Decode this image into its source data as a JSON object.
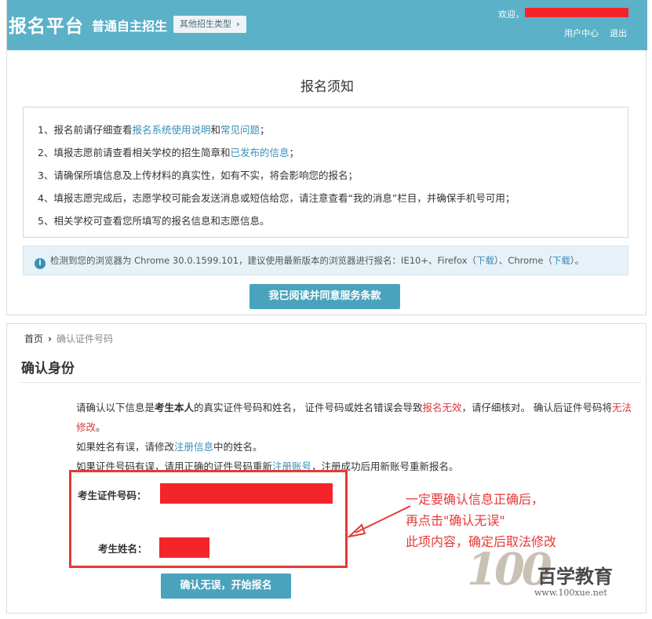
{
  "header": {
    "logo": "报名平台",
    "type_name": "普通自主招生",
    "other_types_label": "其他招生类型",
    "welcome": "欢迎，",
    "user_center": "用户中心",
    "logout": "退出"
  },
  "notice": {
    "title": "报名须知",
    "item1": {
      "a": "1、报名前请仔细查看",
      "link1": "报名系统使用说明",
      "b": "和",
      "link2": "常见问题",
      "c": "；"
    },
    "item2": {
      "a": "2、填报志愿前请查看相关学校的招生简章和",
      "link1": "已发布的信息",
      "b": "；"
    },
    "item3": "3、请确保所填信息及上传材料的真实性，如有不实，将会影响您的报名；",
    "item4": "4、填报志愿完成后，志愿学校可能会发送消息或短信给您，请注意查看“我的消息”栏目，并确保手机号可用；",
    "item5": "5、相关学校可查看您所填写的报名信息和志愿信息。"
  },
  "browser_tip": {
    "a": "检测到您的浏览器为 Chrome 30.0.1599.101，建议使用最新版本的浏览器进行报名：IE10+、Firefox（",
    "download1": "下载",
    "b": "）、Chrome（",
    "download2": "下载",
    "c": "）。"
  },
  "agree_button": "我已阅读并同意服务条款",
  "breadcrumb": {
    "home": "首页",
    "current": "确认证件号码"
  },
  "confirm": {
    "title": "确认身份",
    "p1_a": "请确认以下信息是",
    "p1_b": "考生本人",
    "p1_c": "的真实证件号码和姓名，  证件号码或姓名错误会导致",
    "p1_d": "报名无效",
    "p1_e": "，请仔细核对。  确认后证件号码将",
    "p1_f": "无法修改",
    "p1_g": "。",
    "p2_a": "如果姓名有误，请修改",
    "p2_link": "注册信息",
    "p2_b": "中的姓名。",
    "p3_a": "如果证件号码有误，请用正确的证件号码重新",
    "p3_link": "注册账号",
    "p3_b": "，注册成功后用新账号重新报名。",
    "id_label": "考生证件号码：",
    "name_label": "考生姓名：",
    "start_button": "确认无误，开始报名"
  },
  "annotation": {
    "line1": "一定要确认信息正确后，",
    "line2": "再点击\"确认无误\"",
    "line3": "此项内容，确定后取法修改"
  },
  "watermark": {
    "number": "100",
    "name": "百学教育",
    "url": "www.100xue.net"
  },
  "colors": {
    "header": "#5bb1c8",
    "button": "#4aa3bd",
    "link": "#3a8fb5",
    "warning": "#d93a3a",
    "redaction": "#f3252b"
  }
}
